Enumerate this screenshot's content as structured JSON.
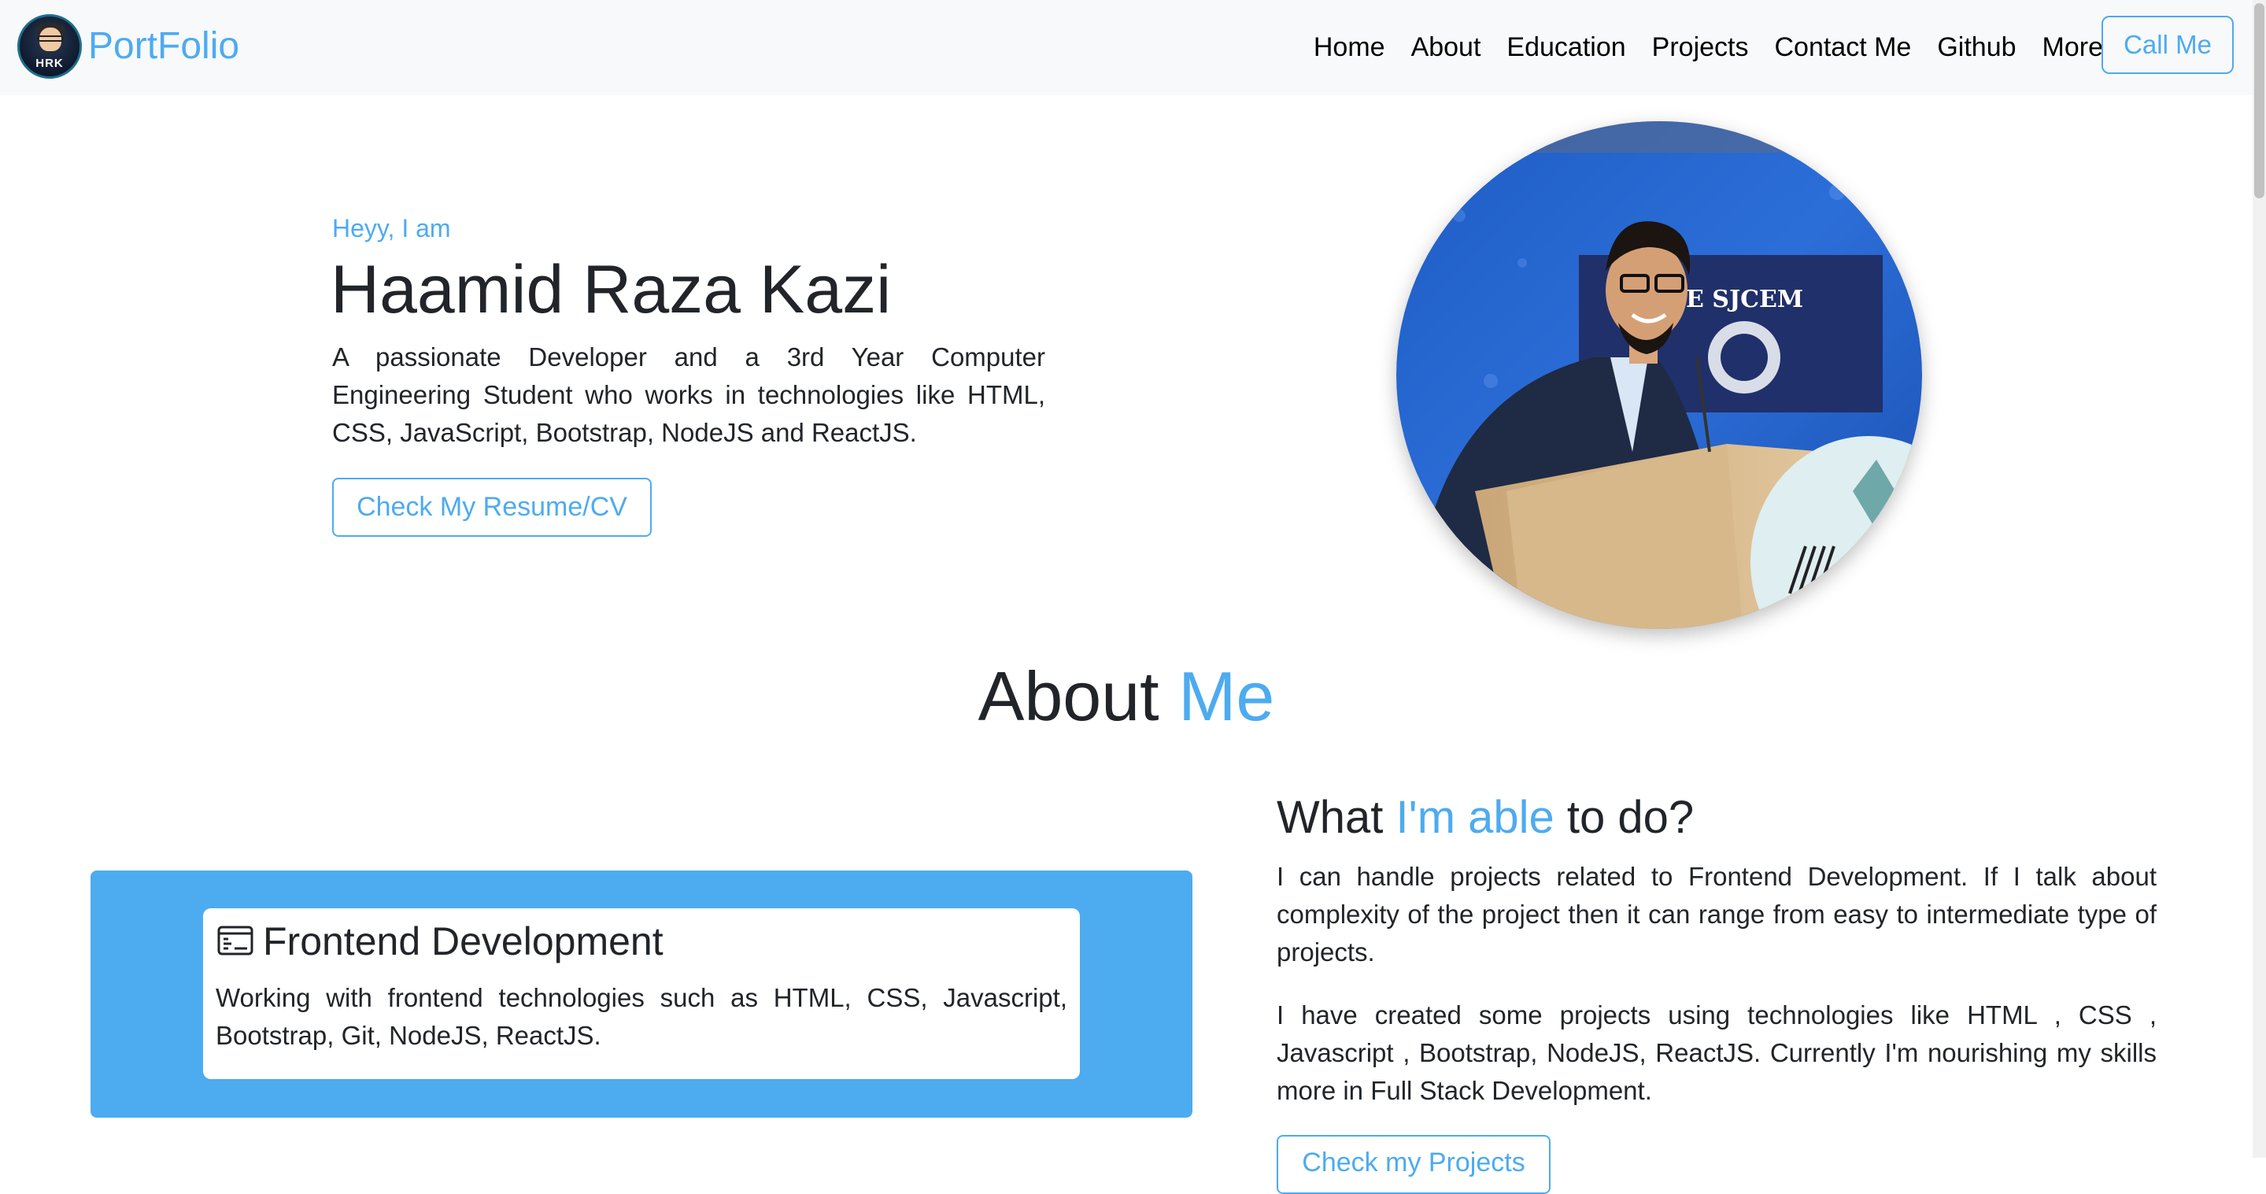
{
  "navbar": {
    "brand_name": "PortFolio",
    "logo_text": "HRK",
    "links": [
      "Home",
      "About",
      "Education",
      "Projects",
      "Contact Me",
      "Github",
      "More"
    ],
    "call_button": "Call Me"
  },
  "hero": {
    "greeting": "Heyy, I am",
    "name": "Haamid Raza Kazi",
    "description": "A passionate Developer and a 3rd Year Computer Engineering Student who works in technologies like HTML, CSS, JavaScript, Bootstrap, NodeJS and ReactJS.",
    "resume_button": "Check My Resume/CV",
    "photo_banner_text": "E SJCEM"
  },
  "about": {
    "title_part1": "About",
    "title_part2": "Me",
    "card": {
      "title": "Frontend Development",
      "text": "Working with frontend technologies such as HTML, CSS, Javascript, Bootstrap, Git, NodeJS, ReactJS."
    },
    "able": {
      "title_part1": "What",
      "title_part2": "I'm able",
      "title_part3": "to do?",
      "paragraph1": "I can handle projects related to Frontend Development. If I talk about complexity of the project then it can range from easy to intermediate type of projects.",
      "paragraph2": "I have created some projects using technologies like HTML , CSS , Javascript , Bootstrap, NodeJS, ReactJS. Currently I'm nourishing my skills more in Full Stack Development.",
      "projects_button": "Check my Projects"
    }
  },
  "colors": {
    "accent": "#4dabf0",
    "navbar_bg": "#f8f9fa",
    "text": "#212529"
  },
  "icons": {
    "card_icon": "terminal-window-icon"
  }
}
